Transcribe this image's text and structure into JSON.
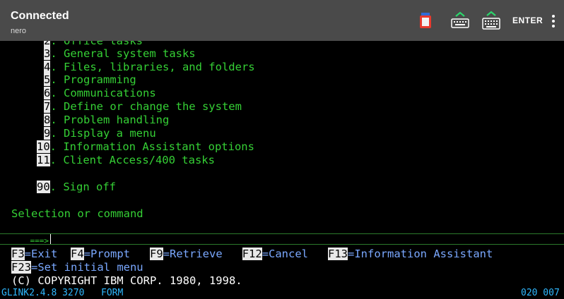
{
  "app": {
    "title": "Connected",
    "subtitle": "nero",
    "enter_label": "ENTER",
    "icons": [
      "clipboard-icon",
      "keyboard-icon",
      "keyboard-icon",
      "more-icon"
    ]
  },
  "menu": {
    "partial_line": ". Office tasks",
    "items": [
      {
        "num": "3",
        "label": ". General system tasks"
      },
      {
        "num": "4",
        "label": ". Files, libraries, and folders"
      },
      {
        "num": "5",
        "label": ". Programming"
      },
      {
        "num": "6",
        "label": ". Communications"
      },
      {
        "num": "7",
        "label": ". Define or change the system"
      },
      {
        "num": "8",
        "label": ". Problem handling"
      },
      {
        "num": "9",
        "label": ". Display a menu"
      },
      {
        "num": "10",
        "label": ". Information Assistant options"
      },
      {
        "num": "11",
        "label": ". Client Access/400 tasks"
      }
    ],
    "signoff": {
      "num": "90",
      "label": ". Sign off"
    }
  },
  "command": {
    "prompt_label": "Selection or command",
    "arrow": "===>",
    "value": ""
  },
  "fkeys": {
    "row1": [
      {
        "key": "F3",
        "label": "=Exit"
      },
      {
        "key": "F4",
        "label": "=Prompt"
      },
      {
        "key": "F9",
        "label": "=Retrieve"
      },
      {
        "key": "F12",
        "label": "=Cancel"
      },
      {
        "key": "F13",
        "label": "=Information Assistant"
      }
    ],
    "row2": [
      {
        "key": "F23",
        "label": "=Set initial menu"
      }
    ]
  },
  "copyright": "(C) COPYRIGHT IBM CORP. 1980, 1998.",
  "status": {
    "left": "GLINK2.4.8 3270",
    "mode": "FORM",
    "position": "020 007"
  },
  "colors": {
    "appbar": "#4a4a4a",
    "terminal_bg": "#000000",
    "green": "#35d035",
    "blue": "#7aa8ff",
    "status": "#2fb8ff"
  }
}
